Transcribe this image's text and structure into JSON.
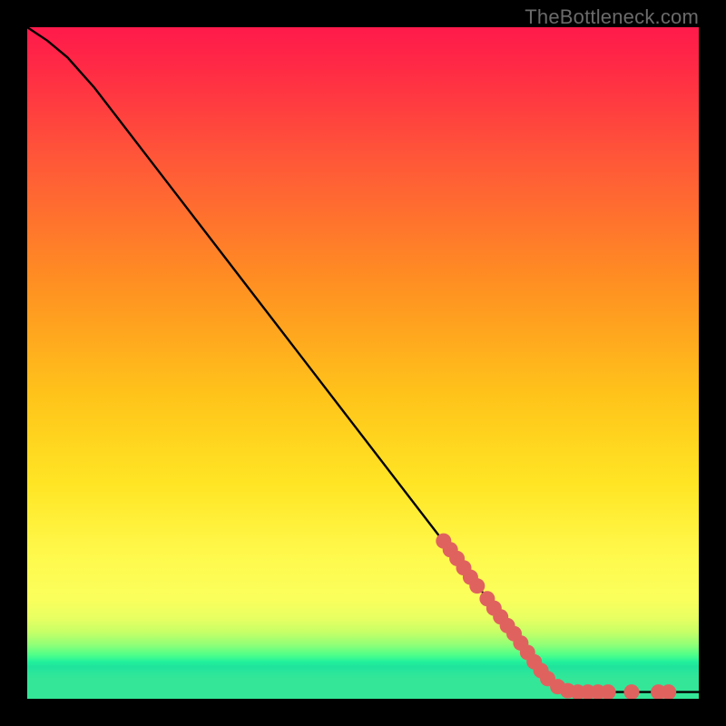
{
  "attribution": "TheBottleneck.com",
  "chart_data": {
    "type": "line",
    "title": "",
    "xlabel": "",
    "ylabel": "",
    "xlim": [
      0,
      100
    ],
    "ylim": [
      0,
      100
    ],
    "curve": [
      {
        "x": 0,
        "y": 100
      },
      {
        "x": 3,
        "y": 98
      },
      {
        "x": 6,
        "y": 95.5
      },
      {
        "x": 10,
        "y": 91
      },
      {
        "x": 20,
        "y": 78
      },
      {
        "x": 30,
        "y": 65
      },
      {
        "x": 40,
        "y": 52
      },
      {
        "x": 50,
        "y": 39
      },
      {
        "x": 60,
        "y": 26
      },
      {
        "x": 70,
        "y": 13
      },
      {
        "x": 78,
        "y": 3
      },
      {
        "x": 80,
        "y": 1.5
      },
      {
        "x": 85,
        "y": 1
      },
      {
        "x": 100,
        "y": 1
      }
    ],
    "highlight_points": [
      {
        "x": 62,
        "y": 23.5
      },
      {
        "x": 63,
        "y": 22.2
      },
      {
        "x": 64,
        "y": 20.9
      },
      {
        "x": 65,
        "y": 19.5
      },
      {
        "x": 66,
        "y": 18.1
      },
      {
        "x": 67,
        "y": 16.8
      },
      {
        "x": 68.5,
        "y": 14.9
      },
      {
        "x": 69.5,
        "y": 13.5
      },
      {
        "x": 70.5,
        "y": 12.2
      },
      {
        "x": 71.5,
        "y": 10.9
      },
      {
        "x": 72.5,
        "y": 9.7
      },
      {
        "x": 73.5,
        "y": 8.3
      },
      {
        "x": 74.5,
        "y": 6.9
      },
      {
        "x": 75.5,
        "y": 5.5
      },
      {
        "x": 76.5,
        "y": 4.2
      },
      {
        "x": 77.5,
        "y": 3.0
      },
      {
        "x": 79,
        "y": 1.8
      },
      {
        "x": 80.5,
        "y": 1.2
      },
      {
        "x": 82,
        "y": 1.0
      },
      {
        "x": 83.5,
        "y": 1.0
      },
      {
        "x": 85,
        "y": 1.0
      },
      {
        "x": 86.5,
        "y": 1.0
      },
      {
        "x": 90,
        "y": 1.0
      },
      {
        "x": 94,
        "y": 1.0
      },
      {
        "x": 95.5,
        "y": 1.0
      }
    ],
    "colors": {
      "curve": "#000000",
      "highlight": "#e0625f"
    }
  }
}
